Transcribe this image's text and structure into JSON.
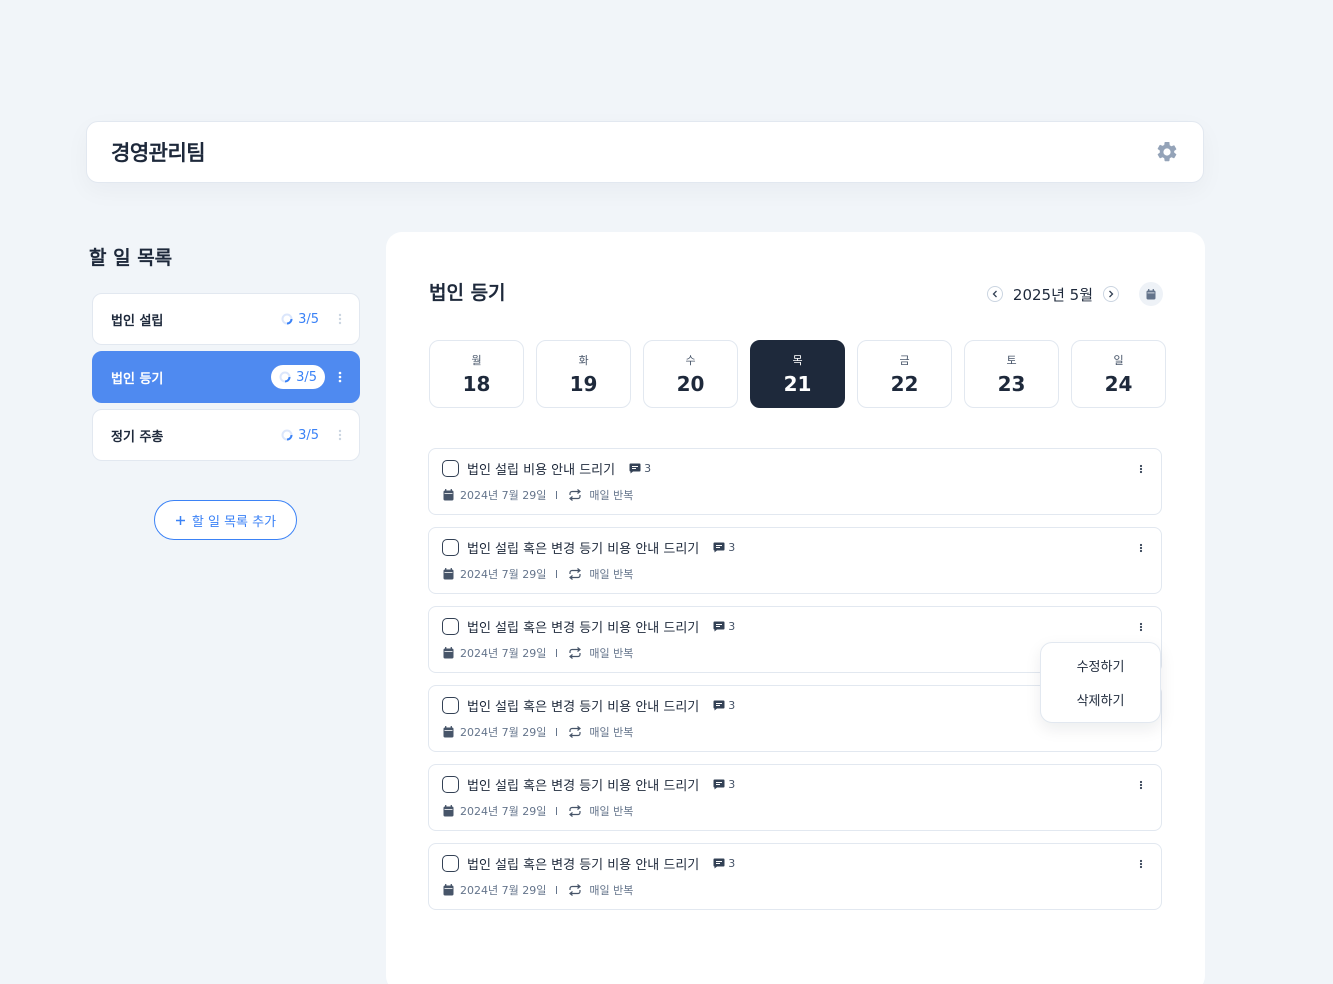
{
  "header": {
    "team_name": "경영관리팀",
    "settings_icon": "gear-icon"
  },
  "sidebar": {
    "title": "할 일 목록",
    "items": [
      {
        "label": "법인 설립",
        "progress": "3/5",
        "progress_fraction": 0.6,
        "active": false
      },
      {
        "label": "법인 등기",
        "progress": "3/5",
        "progress_fraction": 0.6,
        "active": true
      },
      {
        "label": "정기 주총",
        "progress": "3/5",
        "progress_fraction": 0.6,
        "active": false
      }
    ],
    "add_button": "할 일 목록 추가"
  },
  "main": {
    "title": "법인 등기",
    "month": "2025년 5월",
    "days": [
      {
        "dow": "월",
        "num": "18"
      },
      {
        "dow": "화",
        "num": "19"
      },
      {
        "dow": "수",
        "num": "20"
      },
      {
        "dow": "목",
        "num": "21",
        "selected": true
      },
      {
        "dow": "금",
        "num": "22"
      },
      {
        "dow": "토",
        "num": "23"
      },
      {
        "dow": "일",
        "num": "24"
      }
    ],
    "tasks": [
      {
        "title": "법인 설립 비용 안내 드리기",
        "comments": "3",
        "date": "2024년 7월 29일",
        "repeat": "매일 반복"
      },
      {
        "title": "법인 설립 혹은 변경 등기 비용 안내 드리기",
        "comments": "3",
        "date": "2024년 7월 29일",
        "repeat": "매일 반복"
      },
      {
        "title": "법인 설립 혹은 변경 등기 비용 안내 드리기",
        "comments": "3",
        "date": "2024년 7월 29일",
        "repeat": "매일 반복"
      },
      {
        "title": "법인 설립 혹은 변경 등기 비용 안내 드리기",
        "comments": "3",
        "date": "2024년 7월 29일",
        "repeat": "매일 반복"
      },
      {
        "title": "법인 설립 혹은 변경 등기 비용 안내 드리기",
        "comments": "3",
        "date": "2024년 7월 29일",
        "repeat": "매일 반복"
      },
      {
        "title": "법인 설립 혹은 변경 등기 비용 안내 드리기",
        "comments": "3",
        "date": "2024년 7월 29일",
        "repeat": "매일 반복"
      }
    ]
  },
  "context_menu": {
    "edit": "수정하기",
    "delete": "삭제하기"
  },
  "colors": {
    "accent": "#4f8af0",
    "dark": "#1e293b",
    "background": "#f1f5f9"
  }
}
